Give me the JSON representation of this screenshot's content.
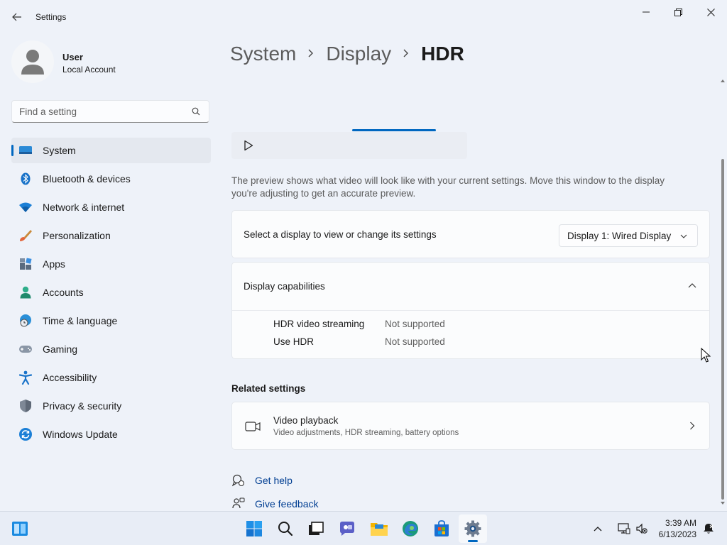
{
  "window": {
    "title": "Settings"
  },
  "user": {
    "name": "User",
    "account_type": "Local Account"
  },
  "search": {
    "placeholder": "Find a setting"
  },
  "nav": {
    "items": [
      {
        "label": "System",
        "icon": "system-icon",
        "active": true
      },
      {
        "label": "Bluetooth & devices",
        "icon": "bluetooth-icon"
      },
      {
        "label": "Network & internet",
        "icon": "wifi-icon"
      },
      {
        "label": "Personalization",
        "icon": "brush-icon"
      },
      {
        "label": "Apps",
        "icon": "apps-icon"
      },
      {
        "label": "Accounts",
        "icon": "person-icon"
      },
      {
        "label": "Time & language",
        "icon": "globe-clock-icon"
      },
      {
        "label": "Gaming",
        "icon": "gamepad-icon"
      },
      {
        "label": "Accessibility",
        "icon": "accessibility-icon"
      },
      {
        "label": "Privacy & security",
        "icon": "shield-icon"
      },
      {
        "label": "Windows Update",
        "icon": "update-icon"
      }
    ]
  },
  "breadcrumb": [
    "System",
    "Display",
    "HDR"
  ],
  "preview": {
    "description": "The preview shows what video will look like with your current settings. Move this window to the display you're adjusting to get an accurate preview."
  },
  "display_select": {
    "label": "Select a display to view or change its settings",
    "selected": "Display 1: Wired Display"
  },
  "capabilities": {
    "title": "Display capabilities",
    "rows": [
      {
        "label": "HDR video streaming",
        "value": "Not supported"
      },
      {
        "label": "Use HDR",
        "value": "Not supported"
      }
    ]
  },
  "related": {
    "title": "Related settings",
    "video_playback": {
      "title": "Video playback",
      "subtitle": "Video adjustments, HDR streaming, battery options"
    }
  },
  "help_links": {
    "get_help": "Get help",
    "give_feedback": "Give feedback"
  },
  "taskbar": {
    "time": "3:39 AM",
    "date": "6/13/2023",
    "apps": [
      "start-icon",
      "search-icon",
      "task-view-icon",
      "chat-icon",
      "file-explorer-icon",
      "edge-icon",
      "store-icon",
      "settings-icon"
    ]
  },
  "colors": {
    "accent": "#0067c0",
    "link": "#003e92",
    "background": "#eef2f9"
  }
}
